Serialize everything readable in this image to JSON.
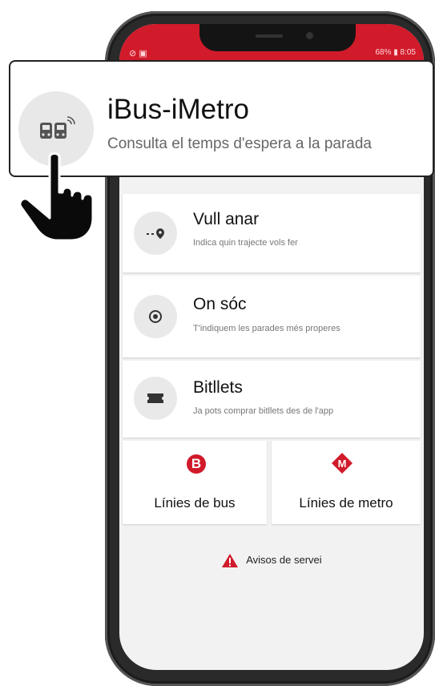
{
  "status_bar": {
    "left": "⊘ ▣",
    "right": "68% ▮ 8:05"
  },
  "promo": {
    "app_name": "iBus-iMetro",
    "description": "Consulta el temps d'espera a la parada"
  },
  "menu": [
    {
      "title": "Vull anar",
      "subtitle": "Indica quin trajecte vols fer",
      "icon": "route-icon"
    },
    {
      "title": "On sóc",
      "subtitle": "T'indiquem les parades més properes",
      "icon": "location-icon"
    },
    {
      "title": "Bitllets",
      "subtitle": "Ja pots comprar bitllets des de l'app",
      "icon": "ticket-icon"
    }
  ],
  "tiles": {
    "bus": {
      "badge": "B",
      "label": "Línies de bus"
    },
    "metro": {
      "badge": "M",
      "label": "Línies de metro"
    }
  },
  "alerts": {
    "label": "Avisos de servei"
  },
  "colors": {
    "brand_red": "#d11a2a",
    "background": "#f2f2f2"
  }
}
